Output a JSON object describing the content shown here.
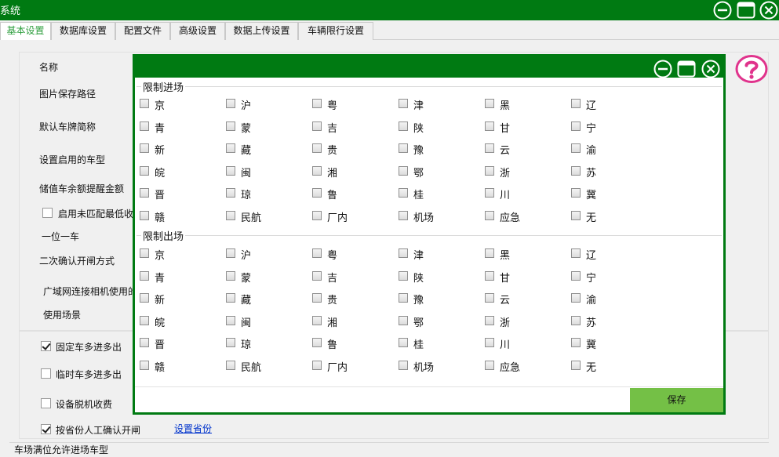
{
  "window": {
    "title": "系统"
  },
  "tabs": [
    "基本设置",
    "数据库设置",
    "配置文件",
    "高级设置",
    "数据上传设置",
    "车辆限行设置"
  ],
  "form": {
    "name_label": "名称",
    "image_path_label": "图片保存路径",
    "default_plate_prefix_label": "默认车牌简称",
    "enabled_vehicle_types_label": "设置启用的车型",
    "stored_value_alert_label": "储值车余额提醒金额",
    "unmatched_min_label": "启用未匹配最低收",
    "one_slot_one_car_label": "一位一车",
    "second_confirm_label": "二次确认开闸方式",
    "wan_camera_label": "广域网连接相机使用的",
    "usage_scene_label": "使用场景"
  },
  "options": {
    "fixed_multi_in_out": {
      "label": "固定车多进多出",
      "checked": true
    },
    "temp_multi_in_out": {
      "label": "临时车多进多出",
      "checked": false
    },
    "offline_charge": {
      "label": "设备脱机收费",
      "checked": false
    },
    "province_manual_confirm": {
      "label": "按省份人工确认开闸",
      "checked": true
    },
    "set_province_link": "设置省份"
  },
  "bottom_group_label": "车场满位允许进场车型",
  "dialog": {
    "entry_title": "限制进场",
    "exit_title": "限制出场",
    "regions": [
      [
        "京",
        "沪",
        "粤",
        "津",
        "黑",
        "辽"
      ],
      [
        "青",
        "蒙",
        "吉",
        "陕",
        "甘",
        "宁"
      ],
      [
        "新",
        "藏",
        "贵",
        "豫",
        "云",
        "渝"
      ],
      [
        "皖",
        "闽",
        "湘",
        "鄂",
        "浙",
        "苏"
      ],
      [
        "晋",
        "琼",
        "鲁",
        "桂",
        "川",
        "冀"
      ],
      [
        "赣",
        "民航",
        "厂内",
        "机场",
        "应急",
        "无"
      ]
    ],
    "save_label": "保存"
  },
  "colors": {
    "titlebar": "#007a12",
    "active_tab": "#2e9e3e",
    "save_button": "#74c046",
    "help_icon": "#e0338c"
  }
}
